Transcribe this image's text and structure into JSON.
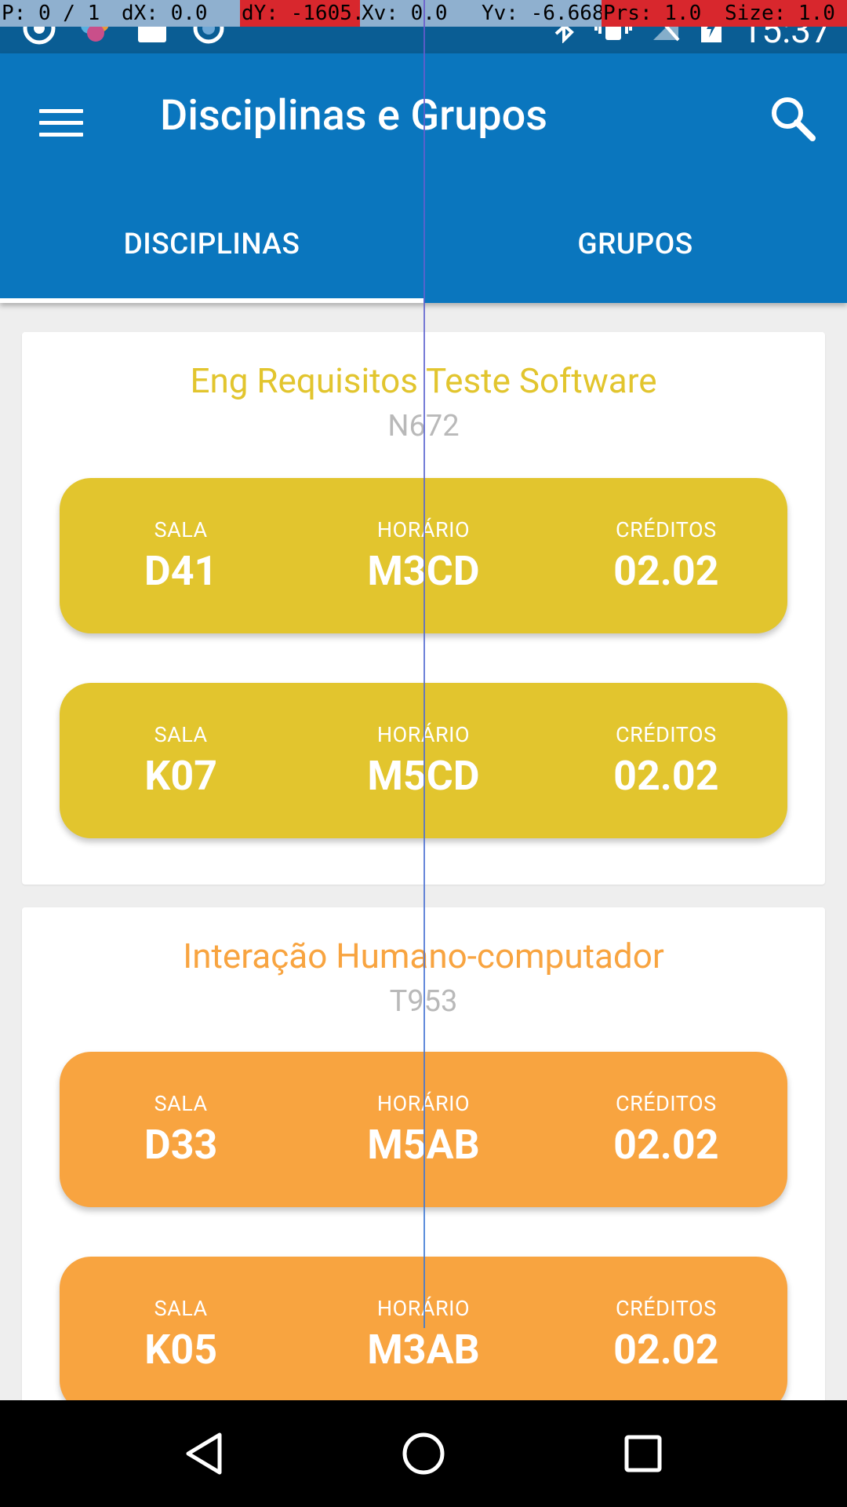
{
  "debug_overlay": {
    "p": "P: 0 / 1",
    "dx": "dX: 0.0",
    "dy": "dY: -1605.0",
    "xv": "Xv: 0.0",
    "yv": "Yv: -6.668",
    "prs": "Prs: 1.0",
    "size": "Size: 1.0"
  },
  "status_bar": {
    "time": "15:37"
  },
  "app_bar": {
    "title": "Disciplinas e Grupos",
    "tabs": [
      {
        "label": "DISCIPLINAS",
        "active": true
      },
      {
        "label": "GRUPOS",
        "active": false
      }
    ]
  },
  "colors": {
    "app_bar": "#0a76be",
    "status_bar": "#0a5d94",
    "yellow": "#e2c52e",
    "orange": "#f8a440",
    "code_gray": "#b9b9b9"
  },
  "courses": [
    {
      "title": "Eng Requisitos Teste Software",
      "code": "N672",
      "color": "#e2c52e",
      "sessions": [
        {
          "sala_label": "SALA",
          "sala": "D41",
          "horario_label": "HORÁRIO",
          "horario": "M3CD",
          "creditos_label": "CRÉDITOS",
          "creditos": "02.02"
        },
        {
          "sala_label": "SALA",
          "sala": "K07",
          "horario_label": "HORÁRIO",
          "horario": "M5CD",
          "creditos_label": "CRÉDITOS",
          "creditos": "02.02"
        }
      ]
    },
    {
      "title": "Interação Humano-computador",
      "code": "T953",
      "color": "#f8a440",
      "sessions": [
        {
          "sala_label": "SALA",
          "sala": "D33",
          "horario_label": "HORÁRIO",
          "horario": "M5AB",
          "creditos_label": "CRÉDITOS",
          "creditos": "02.02"
        },
        {
          "sala_label": "SALA",
          "sala": "K05",
          "horario_label": "HORÁRIO",
          "horario": "M3AB",
          "creditos_label": "CRÉDITOS",
          "creditos": "02.02"
        }
      ]
    }
  ],
  "icons": {
    "menu": "menu-icon",
    "search": "search-icon",
    "back": "back-icon",
    "home": "home-icon",
    "recents": "recents-icon"
  }
}
